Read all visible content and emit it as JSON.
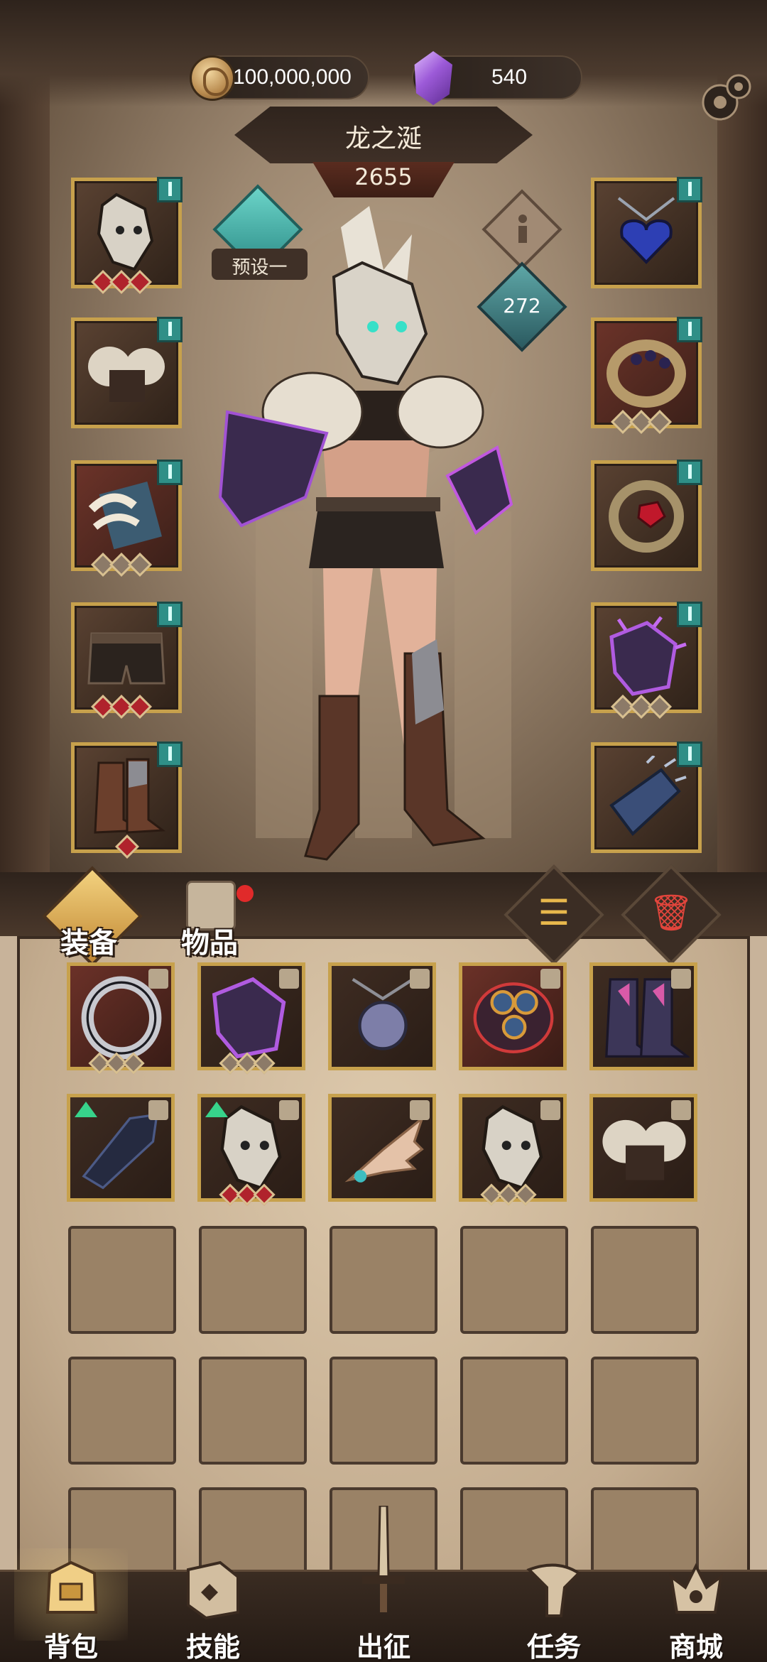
{
  "currency": {
    "gold_value": "100,000,000",
    "gem_value": "540",
    "gold_icon": "coin-icon",
    "gem_icon": "purple-crystal-icon"
  },
  "hero": {
    "name": "龙之涎",
    "power": "2655",
    "level": "272",
    "preset_label": "预设一"
  },
  "equipment": {
    "left": [
      {
        "name": "wolf-skull-mask",
        "stars": [
          "red",
          "red",
          "red"
        ]
      },
      {
        "name": "fur-armor",
        "stars": []
      },
      {
        "name": "horned-bracer",
        "stars": [
          "grey",
          "grey",
          "grey"
        ]
      },
      {
        "name": "leather-shorts",
        "stars": [
          "red",
          "red",
          "red"
        ]
      },
      {
        "name": "leather-boots",
        "stars": [
          "red"
        ]
      }
    ],
    "right": [
      {
        "name": "blue-heart-necklace",
        "stars": []
      },
      {
        "name": "gem-ring",
        "stars": [
          "grey",
          "grey",
          "grey"
        ]
      },
      {
        "name": "red-gem-ring",
        "stars": []
      },
      {
        "name": "thorn-gauntlet",
        "stars": [
          "grey",
          "grey",
          "grey"
        ]
      },
      {
        "name": "feathered-bracer",
        "stars": []
      }
    ]
  },
  "tabs": {
    "equip_label": "装备",
    "items_label": "物品"
  },
  "inventory": {
    "items": [
      {
        "name": "silver-ring",
        "style": "red",
        "locked": true,
        "upgrade": false,
        "stars": [
          "grey",
          "grey",
          "grey"
        ]
      },
      {
        "name": "thorn-claw",
        "style": "dark",
        "locked": true,
        "upgrade": false,
        "stars": [
          "grey",
          "grey",
          "grey"
        ]
      },
      {
        "name": "skull-pendant",
        "style": "dark",
        "locked": true,
        "upgrade": false,
        "stars": []
      },
      {
        "name": "rune-bracelet",
        "style": "red",
        "locked": true,
        "upgrade": false,
        "stars": []
      },
      {
        "name": "crystal-boots",
        "style": "dark",
        "locked": true,
        "upgrade": false,
        "stars": []
      },
      {
        "name": "dark-feather-glove",
        "style": "dark",
        "locked": true,
        "upgrade": true,
        "stars": []
      },
      {
        "name": "wolf-skull-mask",
        "style": "dark",
        "locked": true,
        "upgrade": true,
        "stars": [
          "red",
          "red",
          "red"
        ]
      },
      {
        "name": "feather-wing",
        "style": "dark",
        "locked": true,
        "upgrade": false,
        "stars": []
      },
      {
        "name": "wolf-skull-mask-2",
        "style": "dark",
        "locked": true,
        "upgrade": false,
        "stars": [
          "grey",
          "grey",
          "grey"
        ]
      },
      {
        "name": "fur-armor-2",
        "style": "dark",
        "locked": true,
        "upgrade": false,
        "stars": []
      }
    ],
    "empty_slots": 15
  },
  "nav": {
    "items": [
      {
        "label": "背包",
        "icon": "backpack-icon",
        "active": true
      },
      {
        "label": "技能",
        "icon": "skill-book-icon",
        "active": false
      },
      {
        "label": "出征",
        "icon": "sword-icon",
        "active": false
      },
      {
        "label": "任务",
        "icon": "quest-horn-icon",
        "active": false
      },
      {
        "label": "商城",
        "icon": "shop-crown-icon",
        "active": false
      }
    ]
  },
  "colors": {
    "gold_border": "#c7a14c",
    "teal": "#2f8f87",
    "red_star": "#b0232c",
    "parchment": "#c8b39a"
  }
}
